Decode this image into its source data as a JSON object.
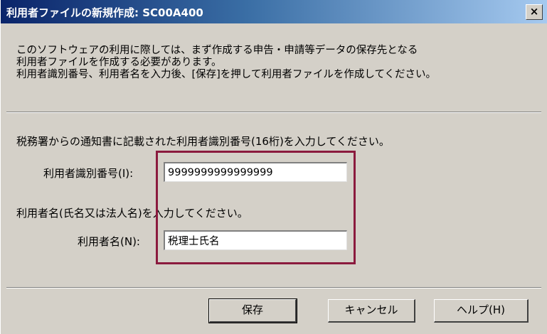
{
  "window": {
    "title": "利用者ファイルの新規作成: SC00A400",
    "close_label": "×"
  },
  "intro": {
    "line1": "このソフトウェアの利用に際しては、まず作成する申告・申請等データの保存先となる",
    "line2": "利用者ファイルを作成する必要があります。",
    "line3": "利用者識別番号、利用者名を入力後、[保存]を押して利用者ファイルを作成してください。"
  },
  "form": {
    "id_instruction": "税務署からの通知書に記載された利用者識別番号(16桁)を入力してください。",
    "id_label": "利用者識別番号(I):",
    "id_value": "9999999999999999",
    "name_instruction": "利用者名(氏名又は法人名)を入力してください。",
    "name_label": "利用者名(N):",
    "name_value": "税理士氏名"
  },
  "buttons": {
    "save": "保存",
    "cancel": "キャンセル",
    "help": "ヘルプ(H)"
  },
  "colors": {
    "title_gradient_start": "#0a246a",
    "title_gradient_end": "#a6caf0",
    "dialog_bg": "#d4d0c8",
    "highlight": "#8b1a3e"
  }
}
